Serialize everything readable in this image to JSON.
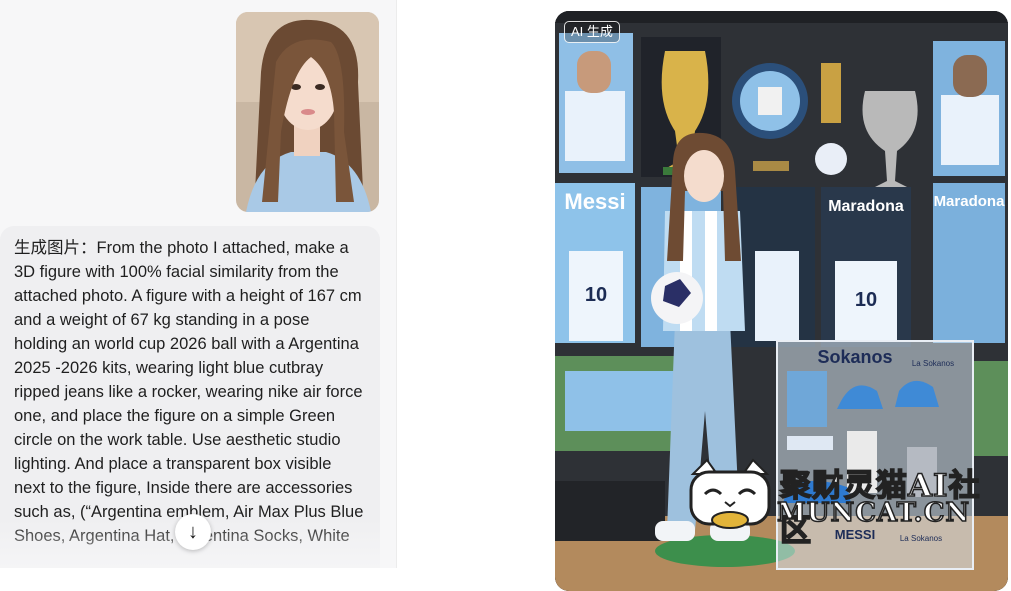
{
  "chat": {
    "prompt_text": "生成图片：From the photo I attached, make a 3D figure with 100% facial similarity from the attached photo. A figure with a height of 167 cm and a weight of 67 kg standing in a pose holding an world cup 2026 ball with a Argentina 2025 -2026 kits, wearing light blue cutbray ripped jeans like a rocker, wearing nike air force one, and place the figure on a simple Green circle on the work table. Use aesthetic studio lighting. And place a transparent box visible next to the figure, Inside there are accessories such as, (“Argentina emblem, ",
    "prompt_tail": "Air Max Plus Blue Shoes, Argentina Hat, Argentina Socks, White",
    "scroll_icon": "arrow-down-icon"
  },
  "result": {
    "ai_badge": "AI 生成",
    "poster_texts": {
      "messi": "Messi",
      "maradona_1": "Maradona",
      "maradona_2": "Maradona",
      "box_brand": "Sokanos",
      "box_brand_small": "La Sokanos",
      "box_messi": "MESSI",
      "box_footer": "La Sokanos",
      "shirt_number_1": "10",
      "shirt_number_2": "10"
    },
    "watermark": {
      "cn": "聚财灵猫AI社区",
      "en": "MUNCAT.CN"
    }
  },
  "colors": {
    "argentina_sky_blue": "#75aadb",
    "wall": "#2b2e33",
    "table": "#b58a5c",
    "base_green": "#3d8f4c"
  }
}
